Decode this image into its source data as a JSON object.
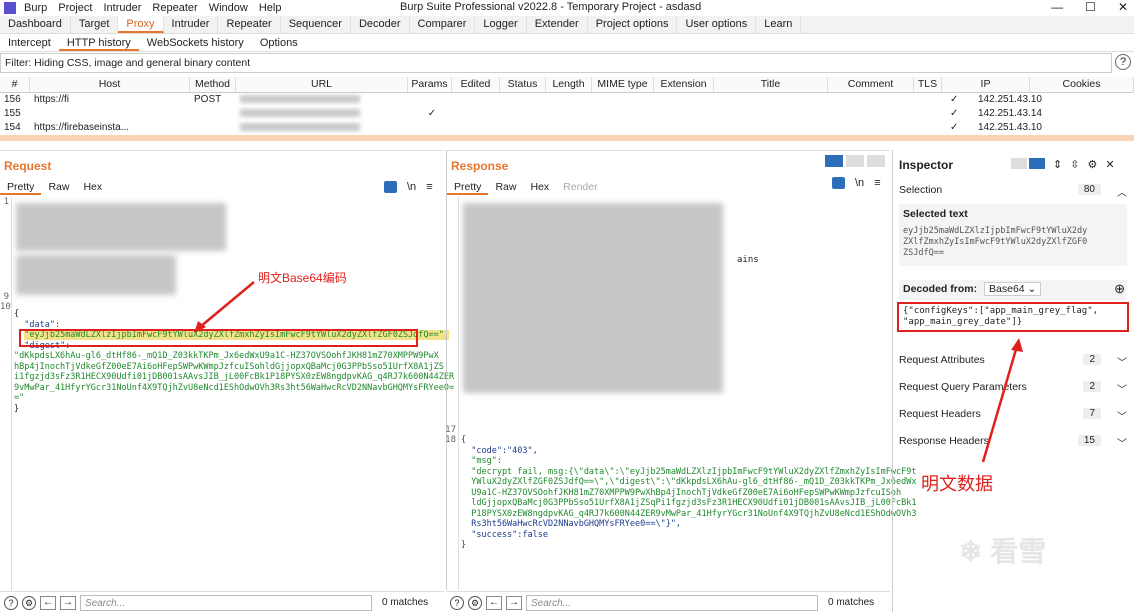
{
  "titlebar": {
    "app": "Burp",
    "menus": [
      "Project",
      "Intruder",
      "Repeater",
      "Window",
      "Help"
    ],
    "title": "Burp Suite Professional v2022.8 - Temporary Project - asdasd"
  },
  "main_tabs": [
    "Dashboard",
    "Target",
    "Proxy",
    "Intruder",
    "Repeater",
    "Sequencer",
    "Decoder",
    "Comparer",
    "Logger",
    "Extender",
    "Project options",
    "User options",
    "Learn"
  ],
  "sub_tabs": [
    "Intercept",
    "HTTP history",
    "WebSockets history",
    "Options"
  ],
  "filter": "Filter: Hiding CSS, image and general binary content",
  "table": {
    "columns": [
      "#",
      "Host",
      "Method",
      "URL",
      "Params",
      "Edited",
      "Status",
      "Length",
      "MIME type",
      "Extension",
      "Title",
      "Comment",
      "TLS",
      "IP",
      "Cookies"
    ],
    "rows": [
      {
        "num": "156",
        "host": "https://fi",
        "method": "POST",
        "ip": "142.251.43.10"
      },
      {
        "num": "155",
        "host": "",
        "method": "",
        "ip": "142.251.43.14"
      },
      {
        "num": "154",
        "host": "https://firebaseinsta...",
        "method": "",
        "ip": "142.251.43.10"
      }
    ]
  },
  "request": {
    "title": "Request",
    "tabs": [
      "Pretty",
      "Raw",
      "Hex"
    ],
    "lines_top": [
      "1",
      "",
      "",
      "",
      "",
      "",
      "",
      "",
      "",
      "9",
      "10"
    ],
    "body": {
      "open": "{",
      "data_key": "\"data\":",
      "data_val": "\"eyJjb25maWdLZXlzIjpbImFwcF9tYWluX2dyZXlfZmxhZyIsImFwcF9tYWluX2dyZXlfZGF0ZSJdfQ==\",",
      "digest_key": "\"digest\":",
      "digest_val": [
        "\"dKkpdsLX6hAu-gl6_dtHf86-_mQ1D_Z03kkTKPm_Jx6edWxU9a1C-HZ37OVSOohfJKH81mZ70XMPPW9PwX",
        "hBp4jInochTjVdkeGfZ00eE7Ai6oHFepSWPwKWmpJzfcuISohldGjjopxQBaMcj0G3PPbSso51UrfX8A1jZS",
        "i1fgzjd3sFz3R1HECX90Udfi01jDB001sAAvsJIB_jL00FcBk1P18PYSX0zEW8ngdpvKAG_q4RJ7k600N44ZER",
        "9vMwPar_41HfyrYGcr31NoUnf4X9TQjhZvU8eNcd1EShOdwOVh3Rs3ht56WaHwcRcVD2NNavbGHQMYsFRYee0=",
        "=\""
      ],
      "close": "}"
    },
    "annotation": "明文Base64编码"
  },
  "response": {
    "title": "Response",
    "tabs": [
      "Pretty",
      "Raw",
      "Hex",
      "Render"
    ],
    "partial": "ains",
    "line17": "17",
    "line18": "18",
    "body": [
      "{",
      "  \"code\":\"403\",",
      "  \"msg\":",
      "  \"decrypt fail, msg:{\\\"data\\\":\\\"eyJjb25maWdLZXlzIjpbImFwcF9tYWluX2dyZXlfZmxhZyIsImFwcF9t",
      "  YWluX2dyZXlfZGF0ZSJdfQ==\\\",\\\"digest\\\":\\\"dKkpdsLX6hAu-gl6_dtHf86-_mQ1D_Z03kkTKPm_Jx6edWx",
      "  U9a1C-HZ37OVSOohfJKH81mZ70XMPPW9PwXhBp4jInochTjVdkeGfZ00eE7Ai6oHFepSWPwKWmpJzfcuISoh",
      "  ldGjjopxQBaMcj0G3PPbSso51UrfX8A1jZSqPi1fgzjd3sFz3R1HECX90Udfi01jDB001sAAvsJIB_jL00FcBk1",
      "  P18PYSX0zEW8ngdpvKAG_q4RJ7k600N44ZER9vMwPar_41HfyrYGcr31NoUnf4X9TQjhZvU8eNcd1EShOdwOVh3",
      "  Rs3ht56WaHwcRcVD2NNavbGHQMYsFRYee0==\\\"}\",",
      "  \"success\":false",
      "}"
    ]
  },
  "bottom": {
    "search_placeholder": "Search...",
    "matches": "0 matches"
  },
  "inspector": {
    "title": "Inspector",
    "selection_label": "Selection",
    "selection_count": "80",
    "selected_text_label": "Selected text",
    "selected_text": [
      "eyJjb25maWdLZXlzIjpbImFwcF9tYWluX2dy",
      "ZXlfZmxhZyIsImFwcF9tYWluX2dyZXlfZGF0",
      "ZSJdfQ=="
    ],
    "decoded_from_label": "Decoded from:",
    "decoded_from_value": "Base64",
    "decoded": [
      "{\"configKeys\":[\"app_main_grey_flag\",",
      "\"app_main_grey_date\"]}"
    ],
    "sections": [
      {
        "label": "Request Attributes",
        "count": "2"
      },
      {
        "label": "Request Query Parameters",
        "count": "2"
      },
      {
        "label": "Request Headers",
        "count": "7"
      },
      {
        "label": "Response Headers",
        "count": "15"
      }
    ],
    "annotation": "明文数据"
  },
  "watermark": "看雪",
  "colors": {
    "accent": "#e8772e",
    "annotation": "#e0201d"
  }
}
